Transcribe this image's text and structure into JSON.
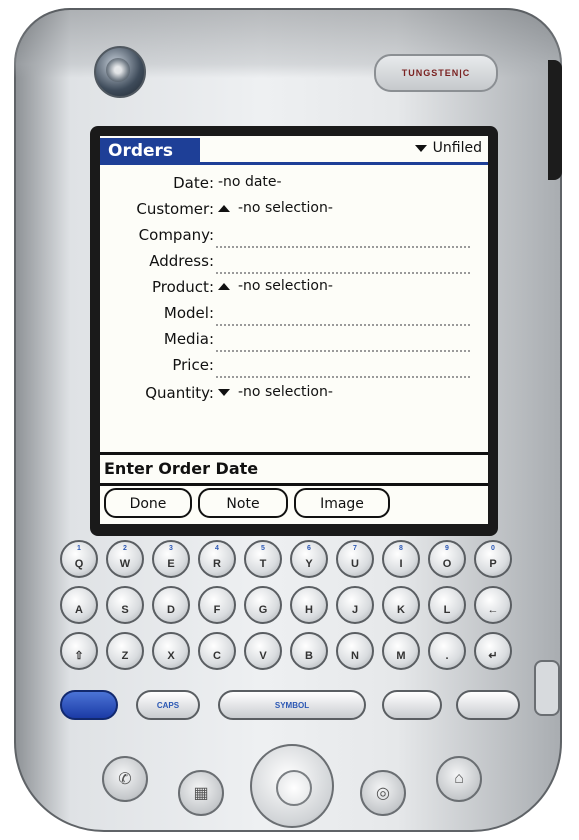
{
  "app": {
    "title": "Orders",
    "category": "Unfiled",
    "brand": "TUNGSTEN|C"
  },
  "form": {
    "rows": [
      {
        "label": "Date:",
        "value": "-no date-",
        "widget": "none"
      },
      {
        "label": "Customer:",
        "value": "-no selection-",
        "widget": "up"
      },
      {
        "label": "Company:",
        "value": "",
        "widget": "line"
      },
      {
        "label": "Address:",
        "value": "",
        "widget": "line"
      },
      {
        "label": "Product:",
        "value": "-no selection-",
        "widget": "up"
      },
      {
        "label": "Model:",
        "value": "",
        "widget": "line"
      },
      {
        "label": "Media:",
        "value": "",
        "widget": "line"
      },
      {
        "label": "Price:",
        "value": "",
        "widget": "line"
      },
      {
        "label": "Quantity:",
        "value": "-no selection-",
        "widget": "down"
      }
    ]
  },
  "help_text": "Enter Order Date",
  "buttons": {
    "done": "Done",
    "note": "Note",
    "image": "Image"
  },
  "keyboard": {
    "row1": [
      "Q",
      "W",
      "E",
      "R",
      "T",
      "Y",
      "U",
      "I",
      "O",
      "P"
    ],
    "row2": [
      "A",
      "S",
      "D",
      "F",
      "G",
      "H",
      "J",
      "K",
      "L",
      "←"
    ],
    "row3": [
      "⇧",
      "Z",
      "X",
      "C",
      "V",
      "B",
      "N",
      "M",
      ".",
      "↵"
    ],
    "row1_alt": [
      "1",
      "2",
      "3",
      "4",
      "5",
      "6",
      "7",
      "8",
      "9",
      "0"
    ],
    "row2_alt": [
      "",
      "",
      "",
      "",
      "",
      "",
      "",
      "",
      "",
      ""
    ],
    "row3_alt": [
      "",
      "",
      "",
      "",
      "",
      "",
      "",
      "",
      "",
      ""
    ],
    "caps_label": "CAPS",
    "symbol_label": "SYMBOL"
  },
  "colors": {
    "accent": "#1e3f97",
    "key_alt": "#2c58b4"
  }
}
